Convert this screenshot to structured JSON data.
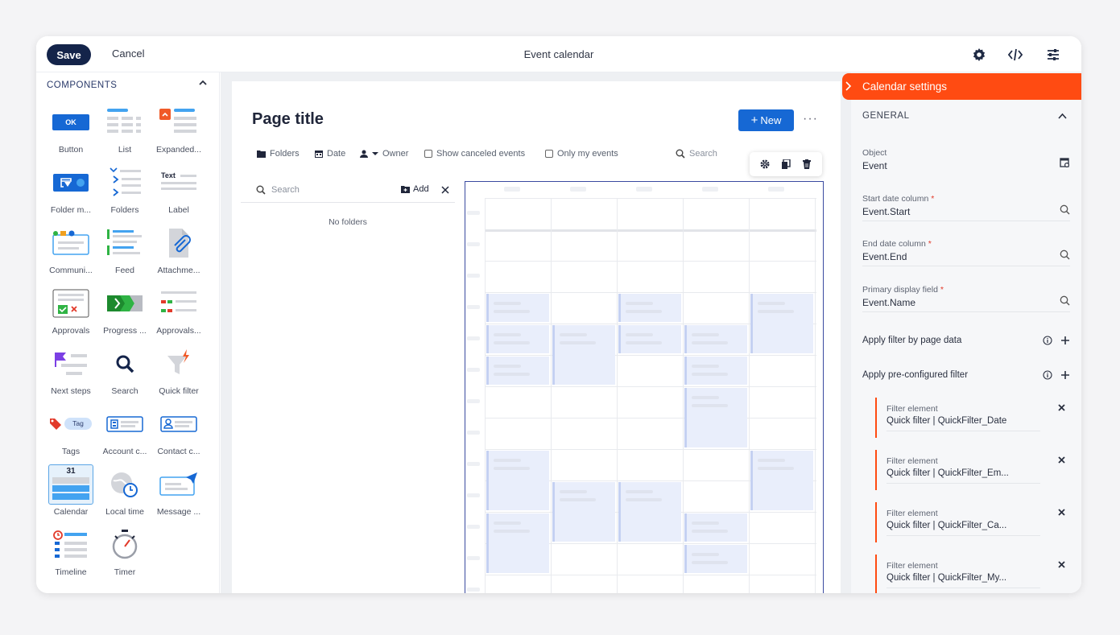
{
  "header": {
    "save_label": "Save",
    "cancel_label": "Cancel",
    "title": "Event calendar"
  },
  "components": {
    "heading": "COMPONENTS",
    "items": [
      {
        "label": "Button",
        "icon": "button-icon"
      },
      {
        "label": "List",
        "icon": "list-icon"
      },
      {
        "label": "Expanded...",
        "icon": "expanded-list-icon"
      },
      {
        "label": "Folder m...",
        "icon": "folder-manager-icon"
      },
      {
        "label": "Folders",
        "icon": "folders-icon"
      },
      {
        "label": "Label",
        "icon": "label-icon"
      },
      {
        "label": "Communi...",
        "icon": "communication-icon"
      },
      {
        "label": "Feed",
        "icon": "feed-icon"
      },
      {
        "label": "Attachme...",
        "icon": "attachment-icon"
      },
      {
        "label": "Approvals",
        "icon": "approvals-icon"
      },
      {
        "label": "Progress ...",
        "icon": "progress-bar-icon"
      },
      {
        "label": "Approvals...",
        "icon": "approvals-list-icon"
      },
      {
        "label": "Next steps",
        "icon": "next-steps-icon"
      },
      {
        "label": "Search",
        "icon": "search-icon"
      },
      {
        "label": "Quick filter",
        "icon": "quick-filter-icon"
      },
      {
        "label": "Tags",
        "icon": "tags-icon"
      },
      {
        "label": "Account c...",
        "icon": "account-compact-icon"
      },
      {
        "label": "Contact c...",
        "icon": "contact-compact-icon"
      },
      {
        "label": "Calendar",
        "icon": "calendar-icon"
      },
      {
        "label": "Local time",
        "icon": "local-time-icon"
      },
      {
        "label": "Message ...",
        "icon": "message-composer-icon"
      },
      {
        "label": "Timeline",
        "icon": "timeline-icon"
      },
      {
        "label": "Timer",
        "icon": "timer-icon"
      }
    ],
    "button_tile_text": "OK",
    "label_tile_text": "Text",
    "tag_tile_text": "Tag",
    "calendar_tile_text": "31"
  },
  "page": {
    "title": "Page title",
    "new_label": "New",
    "more_label": "···",
    "filters": {
      "folders": "Folders",
      "date": "Date",
      "owner": "Owner",
      "show_canceled": "Show canceled events",
      "only_mine": "Only my events",
      "search_placeholder": "Search"
    },
    "folder_panel": {
      "search_placeholder": "Search",
      "add_label": "Add",
      "empty_text": "No folders"
    }
  },
  "settings": {
    "title": "Calendar settings",
    "section": "GENERAL",
    "object_label": "Object",
    "object_value": "Event",
    "start_label": "Start date column",
    "start_value": "Event.Start",
    "end_label": "End date column",
    "end_value": "Event.End",
    "primary_label": "Primary display field",
    "primary_value": "Event.Name",
    "required_mark": "*",
    "apply_page_filter": "Apply filter by page data",
    "apply_preconf_filter": "Apply pre-configured filter",
    "filter_elements": [
      {
        "label": "Filter element",
        "value": "Quick filter | QuickFilter_Date"
      },
      {
        "label": "Filter element",
        "value": "Quick filter | QuickFilter_Em..."
      },
      {
        "label": "Filter element",
        "value": "Quick filter | QuickFilter_Ca..."
      },
      {
        "label": "Filter element",
        "value": "Quick filter | QuickFilter_My..."
      }
    ]
  },
  "colors": {
    "accent": "#ff4b12",
    "primary_button": "#1668d4",
    "save_button": "#14244a"
  }
}
